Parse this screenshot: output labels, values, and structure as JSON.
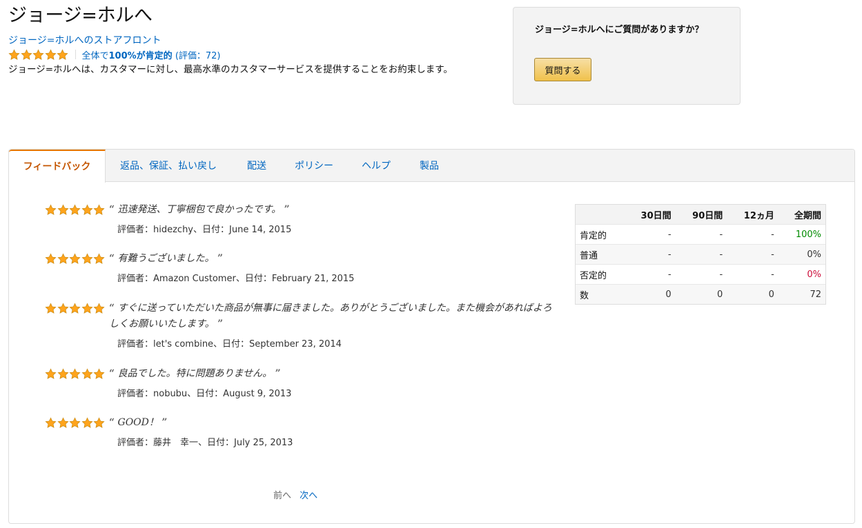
{
  "seller": {
    "name": "ジョージ=ホルへ",
    "storefront_link": "ジョージ=ホルへのストアフロント",
    "rating_stars": 5,
    "rating_prefix": "全体で",
    "rating_percent": "100%が肯定的",
    "rating_count": " (評価：72)",
    "promise": "ジョージ=ホルへは、カスタマーに対し、最高水準のカスタマーサービスを提供することをお約束します。"
  },
  "ask": {
    "title": "ジョージ=ホルへにご質問がありますか？",
    "button_label": "質問する"
  },
  "tabs": [
    {
      "label": "フィードバック",
      "active": true
    },
    {
      "label": "返品、保証、払い戻し",
      "active": false
    },
    {
      "label": "配送",
      "active": false
    },
    {
      "label": "ポリシー",
      "active": false
    },
    {
      "label": "ヘルプ",
      "active": false
    },
    {
      "label": "製品",
      "active": false
    }
  ],
  "reviews": [
    {
      "stars": 5,
      "text": "迅速発送、丁寧梱包で良かったです。",
      "meta": "評価者：hidezchy、日付：June 14, 2015"
    },
    {
      "stars": 5,
      "text": "有難うございました。",
      "meta": "評価者：Amazon Customer、日付：February 21, 2015"
    },
    {
      "stars": 5,
      "text": "すぐに送っていただいた商品が無事に届きました。ありがとうございました。また機会があればよろしくお願いいたします。",
      "meta": "評価者：let's combine、日付：September 23, 2014"
    },
    {
      "stars": 5,
      "text": "良品でした。特に問題ありません。",
      "meta": "評価者：nobubu、日付：August 9, 2013"
    },
    {
      "stars": 5,
      "text": "GOOD！",
      "meta": "評価者：藤井　幸一、日付：July 25, 2013"
    }
  ],
  "pager": {
    "prev": "前へ",
    "next": "次へ"
  },
  "stats": {
    "headers": [
      "",
      "30日間",
      "90日間",
      "12ヵ月",
      "全期間"
    ],
    "rows": [
      {
        "label": "肯定的",
        "values": [
          "-",
          "-",
          "-",
          "100%"
        ]
      },
      {
        "label": "普通",
        "values": [
          "-",
          "-",
          "-",
          "0%"
        ]
      },
      {
        "label": "否定的",
        "values": [
          "-",
          "-",
          "-",
          "0%"
        ]
      },
      {
        "label": "数",
        "values": [
          "0",
          "0",
          "0",
          "72"
        ]
      }
    ]
  },
  "colors": {
    "link": "#0066c0",
    "active_tab": "#c45500",
    "tab_accent": "#e77600",
    "star": "#ffa41c",
    "positive": "#008a00",
    "negative": "#cc0c39"
  }
}
